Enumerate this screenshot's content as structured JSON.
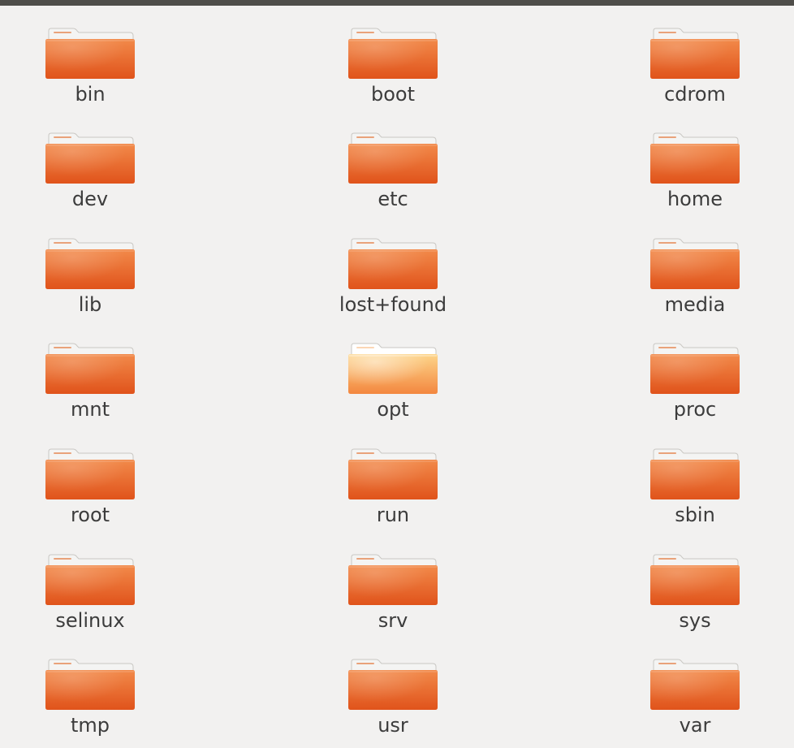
{
  "folders": [
    "bin",
    "boot",
    "cdrom",
    "dev",
    "etc",
    "home",
    "lib",
    "lost+found",
    "media",
    "mnt",
    "opt",
    "proc",
    "root",
    "run",
    "sbin",
    "selinux",
    "srv",
    "sys",
    "tmp",
    "usr",
    "var"
  ],
  "highlighted": "opt",
  "icon": "folder-icon",
  "colors": {
    "folder_top": "#f28a4a",
    "folder_bottom": "#e0531b",
    "folder_highlight_top": "#fdd58a",
    "folder_highlight_bottom": "#f3873f",
    "background": "#f2f1f0",
    "label": "#3c3c3c"
  }
}
